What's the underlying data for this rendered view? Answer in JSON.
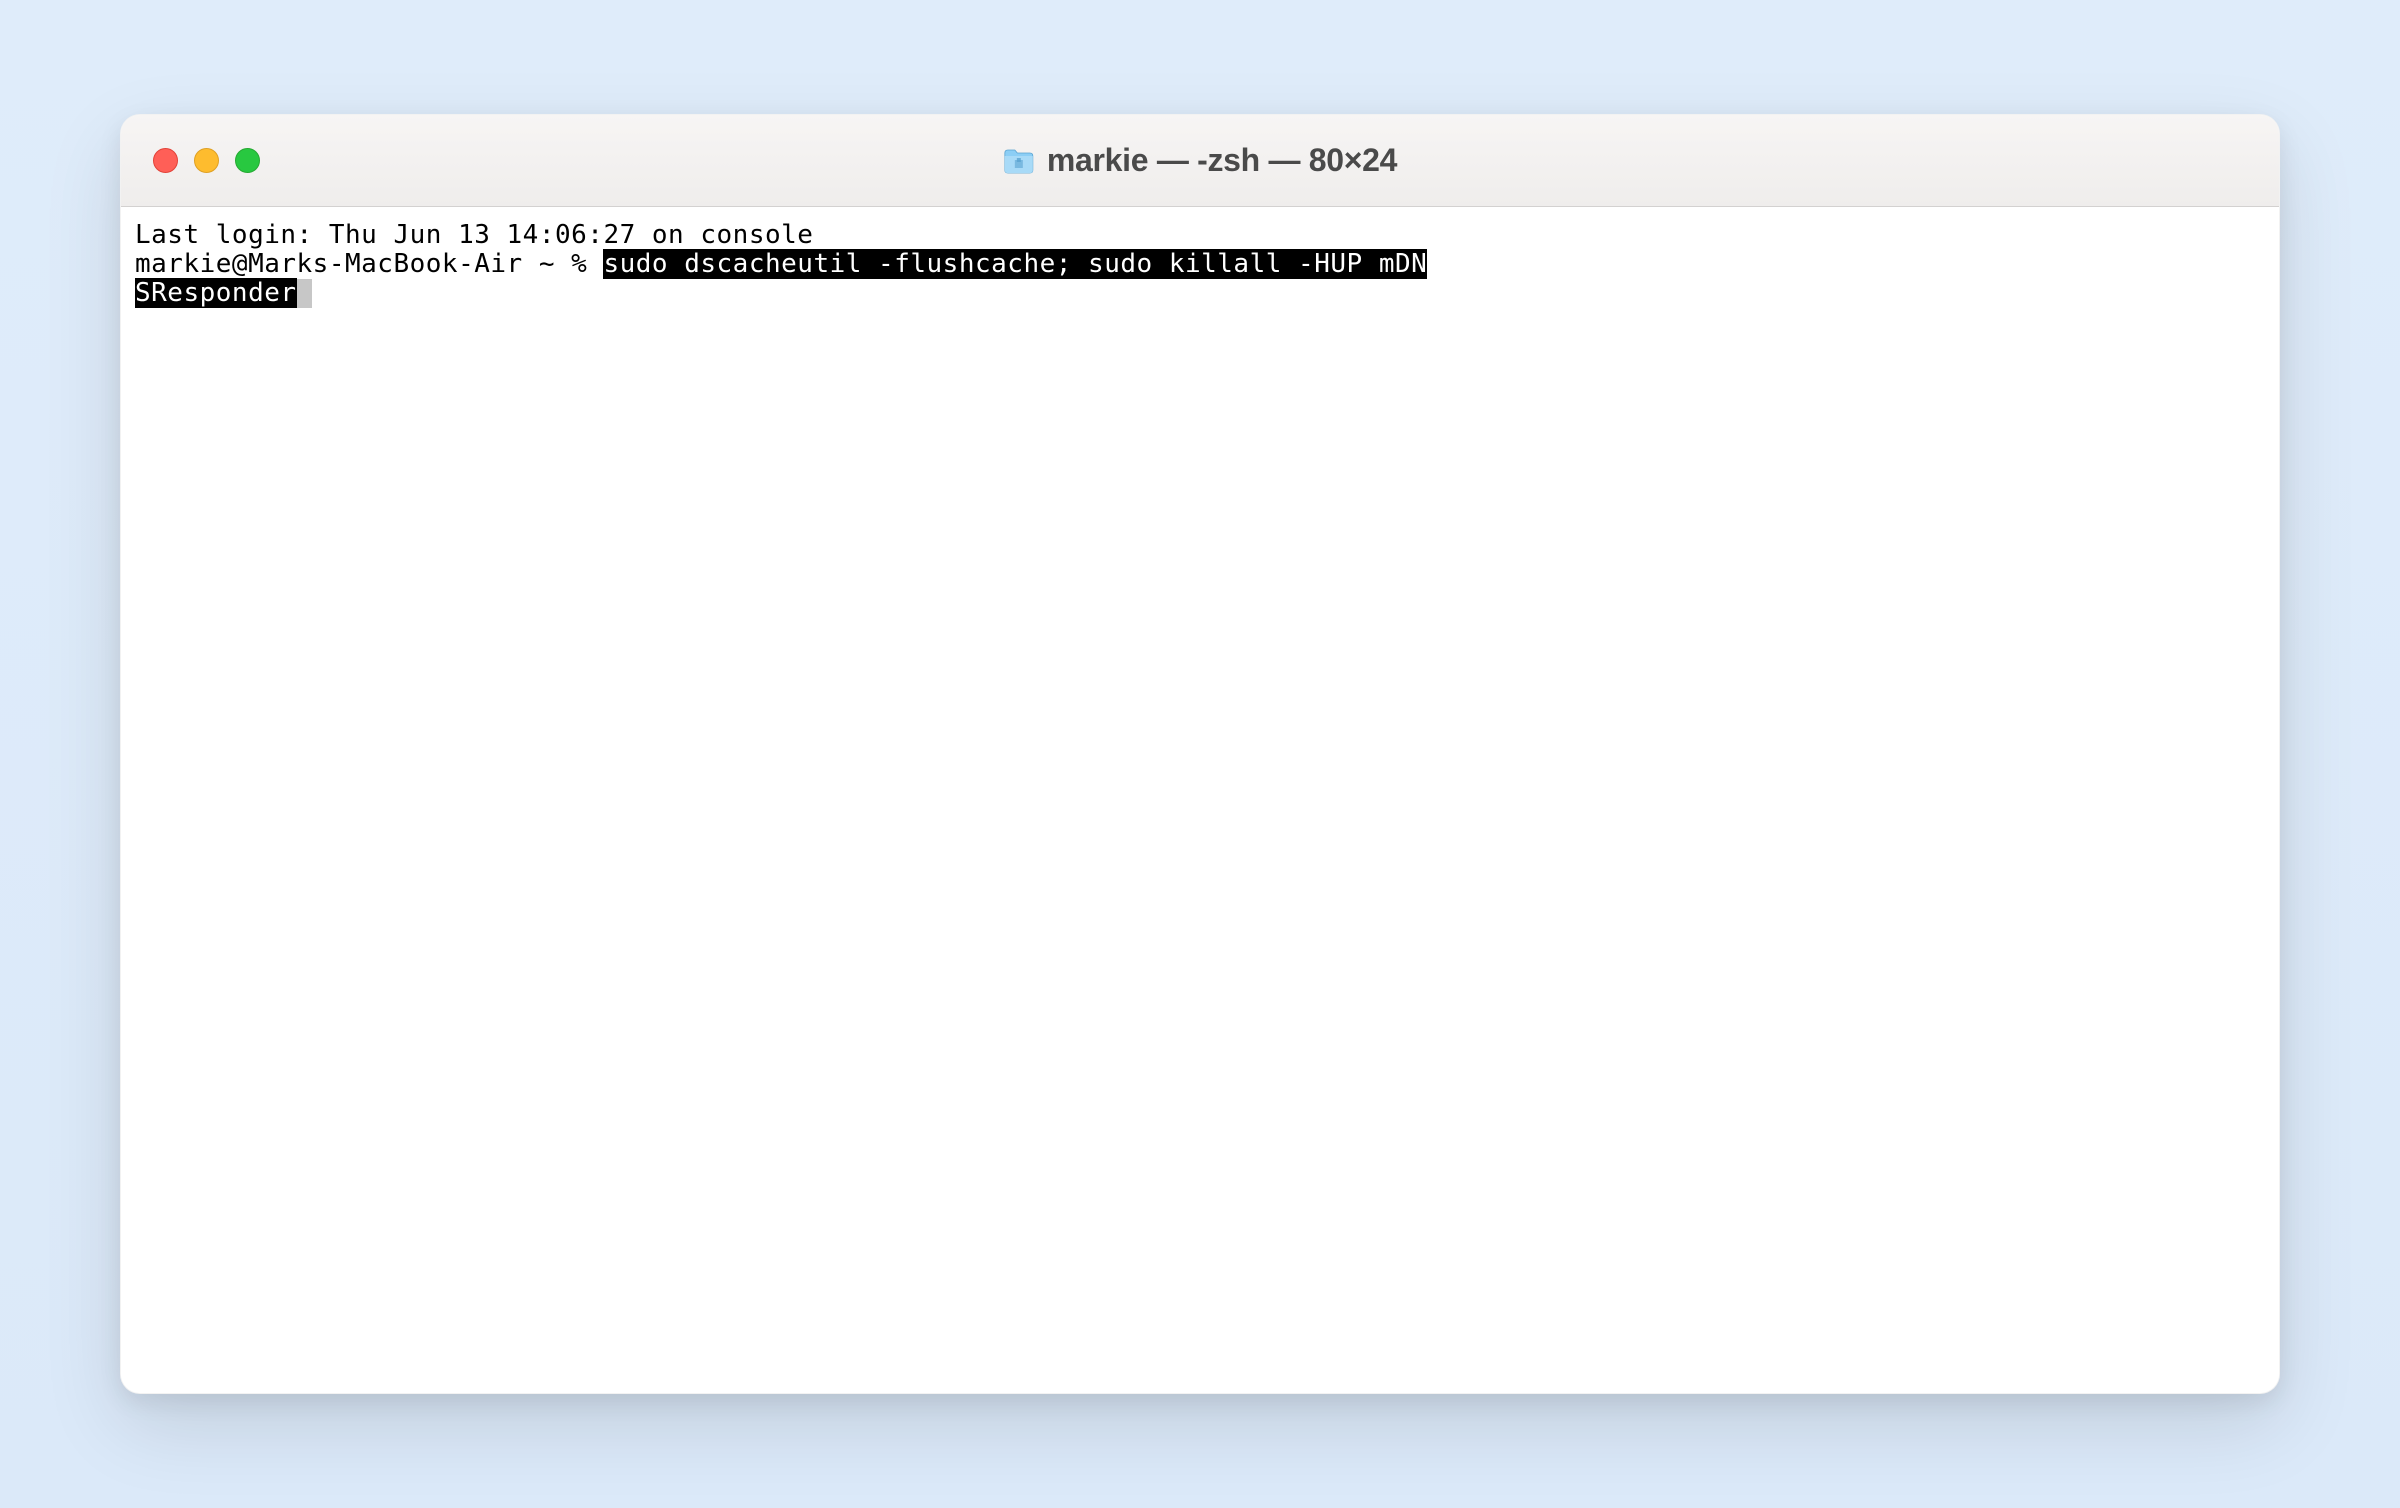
{
  "window": {
    "title": "markie — -zsh — 80×24"
  },
  "terminal": {
    "last_login": "Last login: Thu Jun 13 14:06:27 on console",
    "prompt": "markie@Marks-MacBook-Air ~ % ",
    "command_line1": "sudo dscacheutil -flushcache; sudo killall -HUP mDN",
    "command_line2": "SResponder"
  }
}
